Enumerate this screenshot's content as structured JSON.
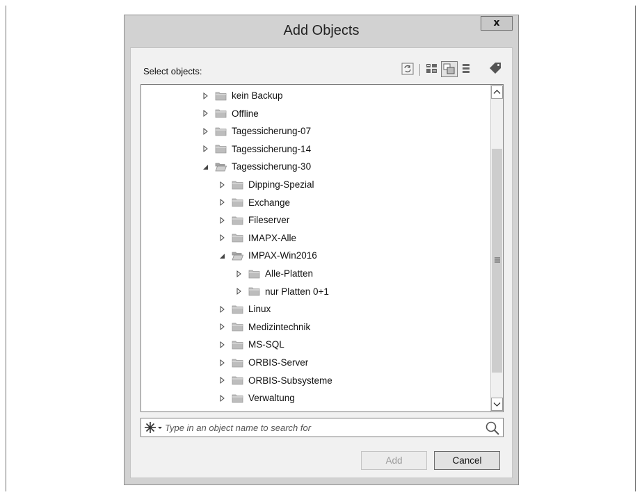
{
  "dialog": {
    "title": "Add Objects",
    "close_label": "x",
    "select_label": "Select objects:",
    "toolbar": [
      "refresh-icon",
      "list-view-icon",
      "tile-view-icon",
      "database-icon",
      "tag-icon"
    ]
  },
  "tree": {
    "items": [
      {
        "label": "kein Backup",
        "level": 0,
        "state": "collapsed"
      },
      {
        "label": "Offline",
        "level": 0,
        "state": "collapsed"
      },
      {
        "label": "Tagessicherung-07",
        "level": 0,
        "state": "collapsed"
      },
      {
        "label": "Tagessicherung-14",
        "level": 0,
        "state": "collapsed"
      },
      {
        "label": "Tagessicherung-30",
        "level": 0,
        "state": "expanded"
      },
      {
        "label": "Dipping-Spezial",
        "level": 1,
        "state": "collapsed"
      },
      {
        "label": "Exchange",
        "level": 1,
        "state": "collapsed"
      },
      {
        "label": "Fileserver",
        "level": 1,
        "state": "collapsed"
      },
      {
        "label": "IMAPX-Alle",
        "level": 1,
        "state": "collapsed"
      },
      {
        "label": "IMPAX-Win2016",
        "level": 1,
        "state": "expanded"
      },
      {
        "label": "Alle-Platten",
        "level": 2,
        "state": "collapsed"
      },
      {
        "label": "nur Platten 0+1",
        "level": 2,
        "state": "collapsed"
      },
      {
        "label": "Linux",
        "level": 1,
        "state": "collapsed"
      },
      {
        "label": "Medizintechnik",
        "level": 1,
        "state": "collapsed"
      },
      {
        "label": "MS-SQL",
        "level": 1,
        "state": "collapsed"
      },
      {
        "label": "ORBIS-Server",
        "level": 1,
        "state": "collapsed"
      },
      {
        "label": "ORBIS-Subsysteme",
        "level": 1,
        "state": "collapsed"
      },
      {
        "label": "Verwaltung",
        "level": 1,
        "state": "collapsed"
      }
    ]
  },
  "search": {
    "placeholder": "Type in an object name to search for",
    "value": ""
  },
  "buttons": {
    "add": "Add",
    "cancel": "Cancel"
  },
  "colors": {
    "dialog_bg": "#d2d2d2",
    "client_bg": "#f1f1f1",
    "folder": "#bdbdbd"
  }
}
